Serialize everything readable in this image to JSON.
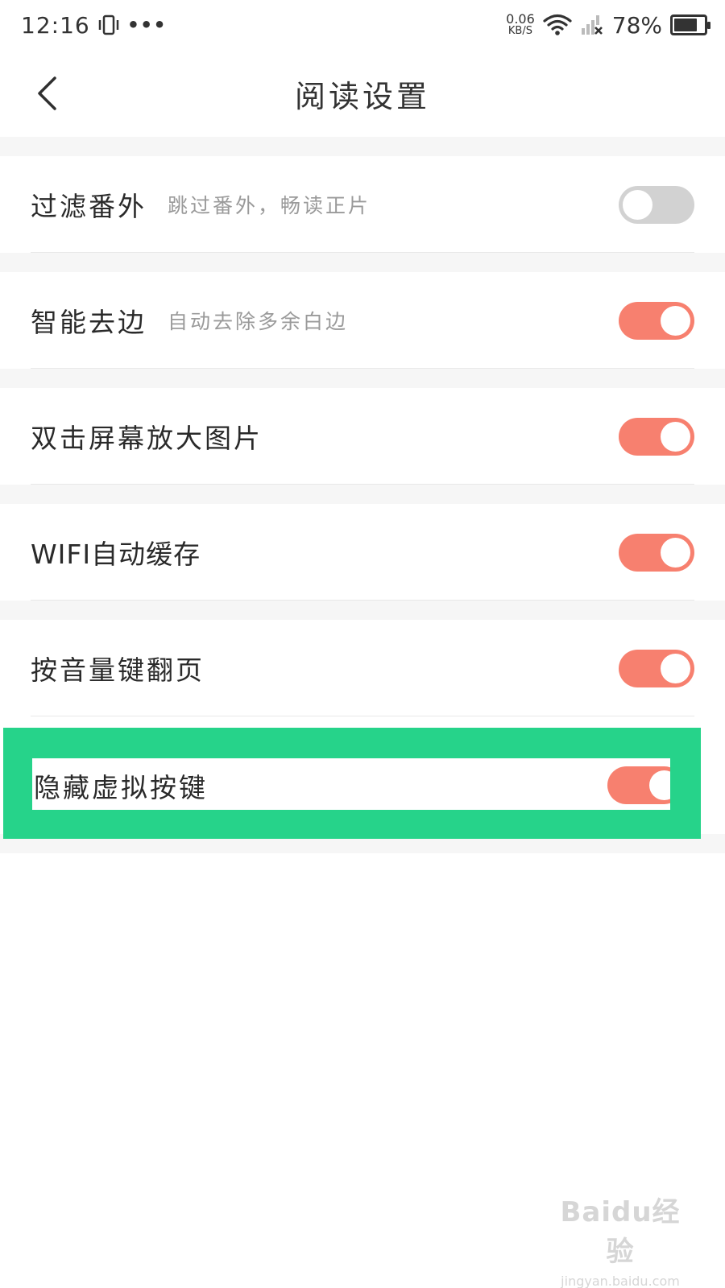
{
  "status_bar": {
    "time": "12:16",
    "more": "•••",
    "speed_value": "0.06",
    "speed_unit": "KB/S",
    "battery_text": "78%",
    "battery_level": 0.78
  },
  "header": {
    "title": "阅读设置",
    "back_icon": "chevron-left-icon"
  },
  "settings": [
    {
      "label": "过滤番外",
      "description": "跳过番外，畅读正片",
      "enabled": false
    },
    {
      "label": "智能去边",
      "description": "自动去除多余白边",
      "enabled": true
    },
    {
      "label": "双击屏幕放大图片",
      "description": "",
      "enabled": true
    },
    {
      "label": "WIFI自动缓存",
      "description": "",
      "enabled": true
    },
    {
      "label": "按音量键翻页",
      "description": "",
      "enabled": true
    },
    {
      "label": "隐藏虚拟按键",
      "description": "",
      "enabled": true
    }
  ],
  "colors": {
    "toggle_on": "#f7806f",
    "toggle_off": "#d2d2d2",
    "highlight": "#26d38a"
  },
  "watermark": {
    "logo": "Baidu经验",
    "url": "jingyan.baidu.com"
  }
}
